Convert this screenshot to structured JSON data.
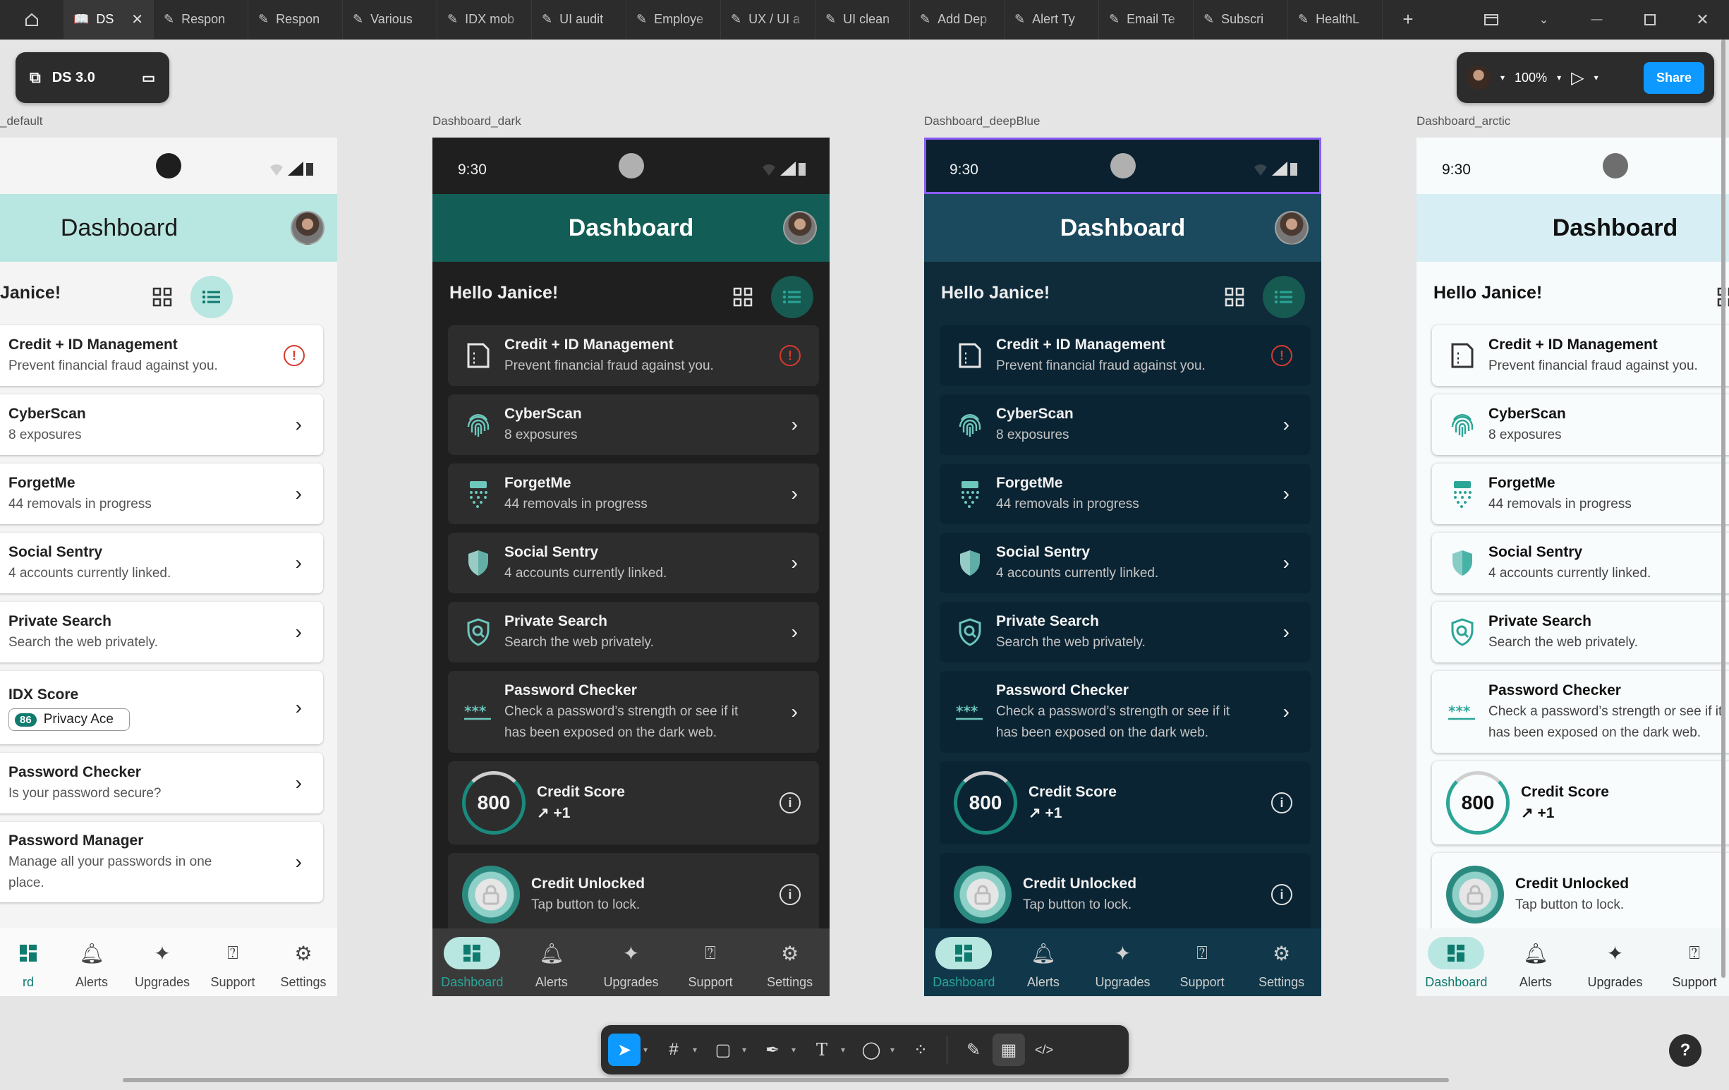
{
  "tabs": [
    {
      "label": "DS",
      "active": true
    },
    {
      "label": "Respon"
    },
    {
      "label": "Respon"
    },
    {
      "label": "Various"
    },
    {
      "label": "IDX mob"
    },
    {
      "label": "UI audit"
    },
    {
      "label": "Employe"
    },
    {
      "label": "UX / UI a"
    },
    {
      "label": "UI clean"
    },
    {
      "label": "Add Dep"
    },
    {
      "label": "Alert Ty"
    },
    {
      "label": "Email Te"
    },
    {
      "label": "Subscri"
    },
    {
      "label": "HealthL"
    }
  ],
  "file": {
    "name": "DS 3.0"
  },
  "toolbar_right": {
    "zoom": "100%",
    "share": "Share"
  },
  "frames": [
    {
      "label": "_default",
      "theme": "light"
    },
    {
      "label": "Dashboard_dark",
      "theme": "dark"
    },
    {
      "label": "Dashboard_deepBlue",
      "theme": "blue"
    },
    {
      "label": "Dashboard_arctic",
      "theme": "arctic"
    }
  ],
  "phone": {
    "time": "9:30",
    "title": "Dashboard",
    "hello": "Hello Janice!",
    "hello_clipped": "Janice!",
    "cards": {
      "credit_id": {
        "title": "Credit + ID Management",
        "sub": "Prevent financial fraud against you."
      },
      "cyberscan": {
        "title": "CyberScan",
        "sub": "8 exposures"
      },
      "forgetme": {
        "title": "ForgetMe",
        "sub": "44 removals in progress"
      },
      "social": {
        "title": "Social Sentry",
        "sub": "4 accounts currently linked."
      },
      "private": {
        "title": "Private Search",
        "sub": "Search the web privately."
      },
      "idx": {
        "title": "IDX Score",
        "score": "86",
        "badge": "Privacy Ace"
      },
      "pw_checker_short": {
        "title": "Password Checker",
        "sub": "Is your password secure?"
      },
      "pw_manager": {
        "title": "Password Manager",
        "sub1": "Manage all your passwords in one",
        "sub2": "place."
      },
      "pw_checker": {
        "title": "Password Checker",
        "sub1": "Check a password’s strength or see if it",
        "sub2": "has been exposed on the dark web."
      },
      "credit_score": {
        "title": "Credit Score",
        "value": "800",
        "delta": "+1"
      },
      "credit_unlocked": {
        "title": "Credit Unlocked",
        "sub": "Tap button to lock."
      }
    },
    "nav": {
      "dashboard": "Dashboard",
      "dashboard_clipped": "rd",
      "alerts": "Alerts",
      "upgrades": "Upgrades",
      "support": "Support",
      "settings": "Settings"
    }
  },
  "colors": {
    "accent": "#0f7a6e",
    "figma_blue": "#0d99ff",
    "selection": "#8a5cf6",
    "alert_red": "#d83a2f"
  }
}
